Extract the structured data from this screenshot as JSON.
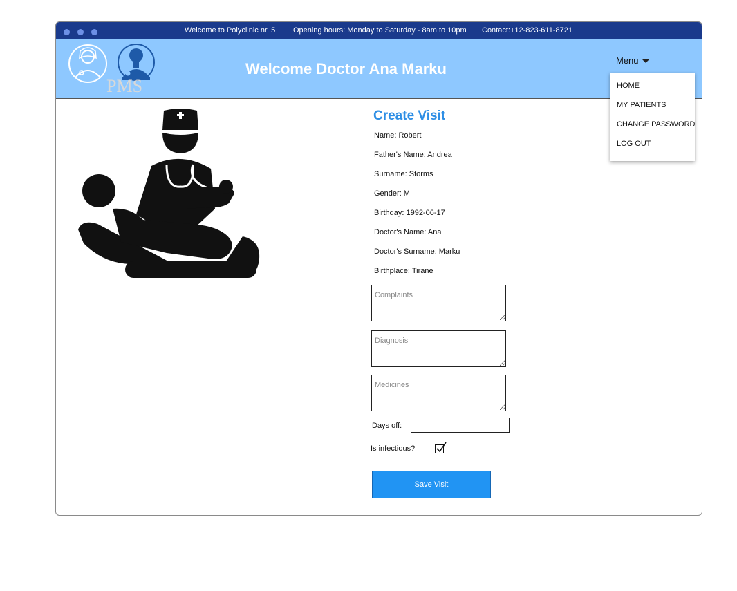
{
  "topbar": {
    "welcome": "Welcome to Polyclinic nr. 5",
    "hours": "Opening hours: Monday to Saturday - 8am to 10pm",
    "contact": "Contact:+12-823-611-8721"
  },
  "header": {
    "logo_text": "PMS",
    "title": "Welcome Doctor Ana Marku",
    "menu_label": "Menu"
  },
  "menu": {
    "items": [
      {
        "label": "HOME"
      },
      {
        "label": "MY PATIENTS"
      },
      {
        "label": "CHANGE PASSWORD"
      },
      {
        "label": "LOG OUT"
      }
    ]
  },
  "form": {
    "title": "Create Visit",
    "fields": [
      {
        "text": "Name: Robert"
      },
      {
        "text": "Father's Name: Andrea"
      },
      {
        "text": "Surname: Storms"
      },
      {
        "text": "Gender: M"
      },
      {
        "text": "Birthday: 1992-06-17"
      },
      {
        "text": "Doctor's Name: Ana"
      },
      {
        "text": "Doctor's Surname: Marku"
      },
      {
        "text": "Birthplace: Tirane"
      }
    ],
    "complaints_placeholder": "Complaints",
    "diagnosis_placeholder": "Diagnosis",
    "medicines_placeholder": "Medicines",
    "days_off_label": "Days off:",
    "days_off_value": "",
    "infectious_label": "Is infectious?",
    "infectious_checked": true,
    "save_label": "Save Visit"
  },
  "colors": {
    "topbar": "#1a3a8c",
    "header": "#8ec8ff",
    "accent": "#2194f3",
    "title": "#2d8ee5"
  }
}
